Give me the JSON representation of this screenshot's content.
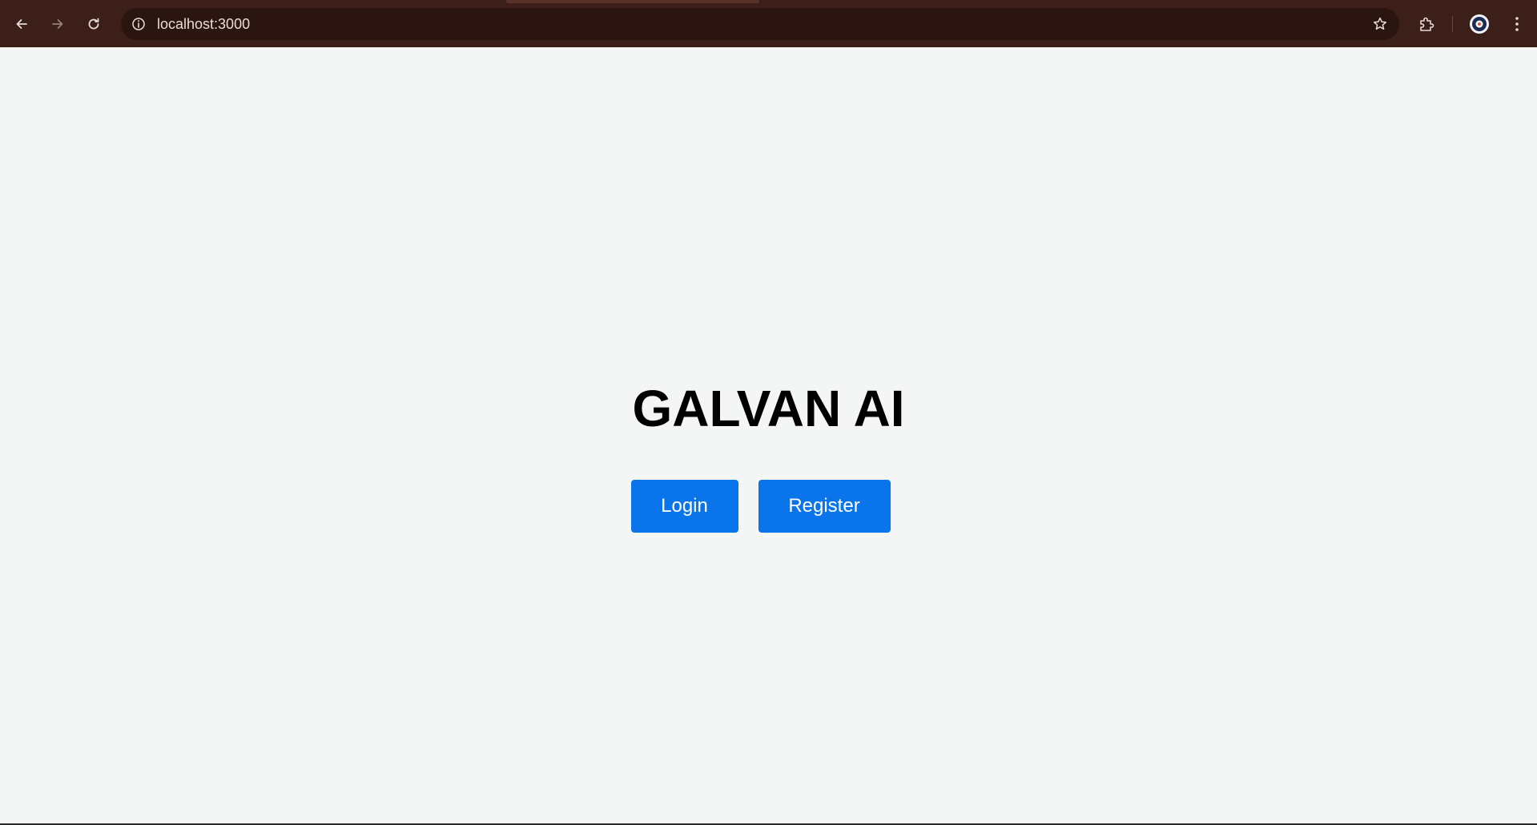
{
  "browser": {
    "url": "localhost:3000",
    "icons": {
      "back": "arrow-left-icon",
      "forward": "arrow-right-icon",
      "reload": "reload-icon",
      "site_info": "info-icon",
      "bookmark": "star-icon",
      "extensions": "puzzle-icon",
      "profile": "profile-avatar-icon",
      "menu": "kebab-menu-icon"
    },
    "colors": {
      "toolbar": "#3c1f18",
      "omnibox": "#2a1510"
    }
  },
  "page": {
    "title": "GALVAN AI",
    "buttons": {
      "login_label": "Login",
      "register_label": "Register"
    },
    "colors": {
      "background": "#f4f5f5",
      "button": "#0a74ea",
      "button_text": "#ffffff",
      "title_text": "#000000"
    }
  }
}
